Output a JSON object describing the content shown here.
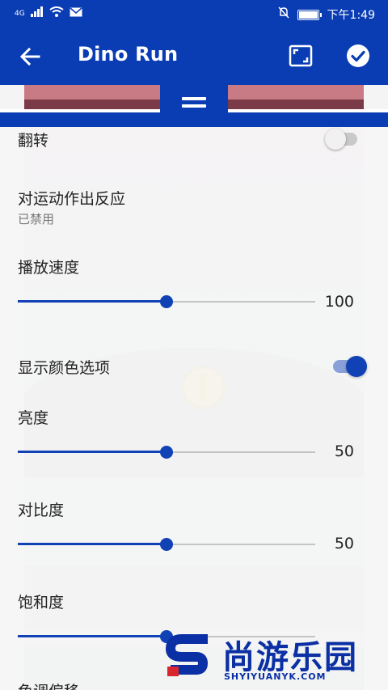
{
  "status_bar": {
    "network": "4G",
    "time": "下午1:49"
  },
  "app_bar": {
    "title": "Dino Run"
  },
  "settings": {
    "flip": {
      "label": "翻转",
      "enabled": false
    },
    "motion": {
      "label": "对运动作出反应",
      "status": "已禁用"
    },
    "speed": {
      "label": "播放速度",
      "value": "100",
      "position": 0.5
    },
    "color_options": {
      "label": "显示颜色选项",
      "enabled": true
    },
    "brightness": {
      "label": "亮度",
      "value": "50",
      "position": 0.5
    },
    "contrast": {
      "label": "对比度",
      "value": "50",
      "position": 0.5
    },
    "saturation": {
      "label": "饱和度",
      "position": 0.5
    },
    "hue": {
      "label": "色调偏移"
    }
  },
  "watermark": {
    "name": "尚游乐园",
    "url": "SHYIYUANYK.COM"
  },
  "colors": {
    "primary": "#0a3db3",
    "accent": "#1142b5"
  }
}
